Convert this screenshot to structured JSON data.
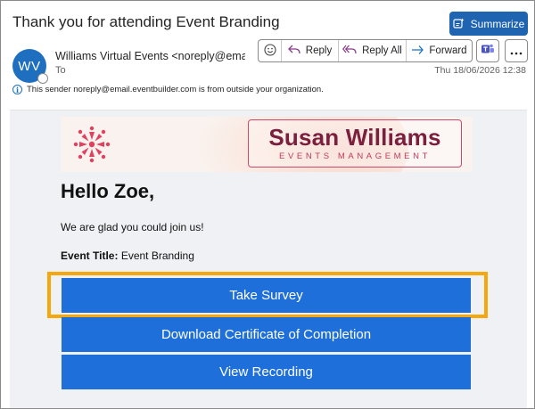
{
  "email": {
    "subject": "Thank you for attending Event Branding",
    "summarize_label": "Summarize",
    "sender": {
      "initials": "WV",
      "display": "Williams Virtual Events <noreply@email.e",
      "to_label": "To"
    },
    "actions": {
      "reply": "Reply",
      "reply_all": "Reply All",
      "forward": "Forward"
    },
    "date": "Thu 18/06/2026 12:38",
    "external_notice": "This sender noreply@email.eventbuilder.com is from outside your organization."
  },
  "message": {
    "brand": {
      "name": "Susan Williams",
      "tagline": "EVENTS MANAGEMENT"
    },
    "greeting": "Hello Zoe,",
    "intro": "We are glad you could join us!",
    "event_title_label": "Event Title:",
    "event_title_value": "Event Branding",
    "buttons": {
      "take_survey": "Take Survey",
      "download_certificate": "Download Certificate of Completion",
      "view_recording": "View Recording"
    }
  },
  "colors": {
    "accent": "#1f6fdb",
    "highlight": "#f5a70b",
    "brand": "#7a1f3d"
  },
  "icons": [
    "summarize-icon",
    "emoji-icon",
    "reply-icon",
    "reply-all-icon",
    "forward-icon",
    "teams-icon",
    "more-icon",
    "info-icon",
    "brand-logo-icon"
  ]
}
